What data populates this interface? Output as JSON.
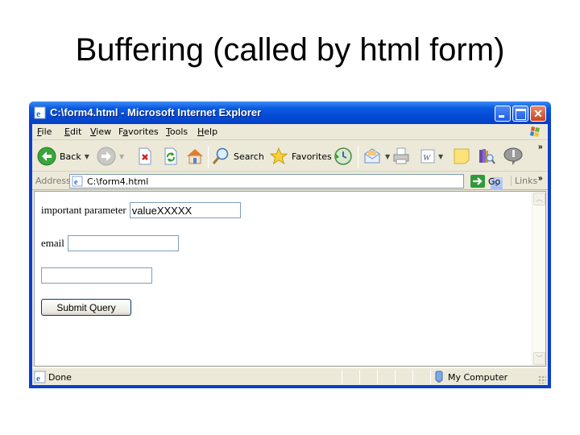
{
  "slide": {
    "title": "Buffering (called by html form)"
  },
  "window": {
    "title": "C:\\form4.html - Microsoft Internet Explorer",
    "controls": {
      "minimize": "minimize",
      "maximize": "maximize",
      "close": "close"
    }
  },
  "menu": {
    "items": [
      {
        "label": "File",
        "accel": "F"
      },
      {
        "label": "Edit",
        "accel": "E"
      },
      {
        "label": "View",
        "accel": "V"
      },
      {
        "label": "Favorites",
        "accel": "a"
      },
      {
        "label": "Tools",
        "accel": "T"
      },
      {
        "label": "Help",
        "accel": "H"
      }
    ]
  },
  "toolbar": {
    "back_label": "Back",
    "search_label": "Search",
    "favorites_label": "Favorites",
    "overflow": "»"
  },
  "address": {
    "label": "Address",
    "value": "C:\\form4.html",
    "go_label": "Go",
    "links_label": "Links",
    "links_overflow": "»"
  },
  "form": {
    "important_parameter_label": "important parameter",
    "important_parameter_value": "valueXXXXX",
    "email_label": "email",
    "email_value": "",
    "third_value": "",
    "submit_label": "Submit Query"
  },
  "statusbar": {
    "status": "Done",
    "zone": "My Computer"
  },
  "icons": {
    "back": "back-arrow-icon",
    "forward": "forward-arrow-icon",
    "stop": "stop-icon",
    "refresh": "refresh-icon",
    "home": "home-icon",
    "search": "magnifier-icon",
    "favorites": "star-icon",
    "history": "history-icon",
    "mail": "mail-icon",
    "print": "printer-icon",
    "edit": "word-icon",
    "discuss": "note-icon",
    "research": "research-icon",
    "messenger": "messenger-icon"
  }
}
